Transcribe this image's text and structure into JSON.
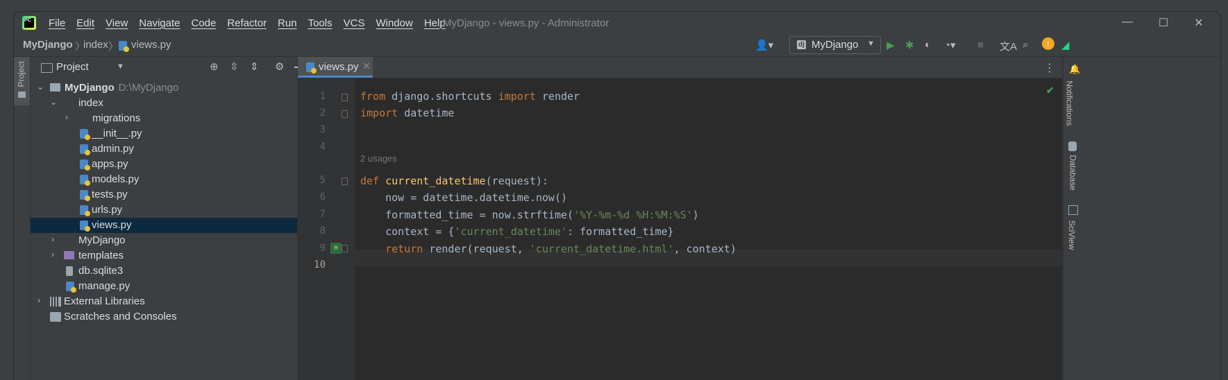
{
  "app": {
    "window_title": "MyDjango - views.py - Administrator",
    "logo_text": "PC",
    "menu": [
      "File",
      "Edit",
      "View",
      "Navigate",
      "Code",
      "Refactor",
      "Run",
      "Tools",
      "VCS",
      "Window",
      "Help"
    ],
    "window_controls": {
      "minimize": "—",
      "maximize": "☐",
      "close": "✕"
    }
  },
  "navbar": {
    "breadcrumbs": [
      "MyDjango",
      "index",
      "views.py"
    ],
    "run_config": "MyDjango",
    "run_config_icon": "dj"
  },
  "left_stripe": {
    "project_tab": "Project"
  },
  "project_panel": {
    "title": "Project",
    "tree": [
      {
        "label": "MyDjango",
        "path": "D:\\MyDjango",
        "indent": 0,
        "expanded": true,
        "icon": "folder"
      },
      {
        "label": "index",
        "indent": 1,
        "expanded": true,
        "icon": "module-folder"
      },
      {
        "label": "migrations",
        "indent": 2,
        "expanded": false,
        "icon": "module-folder"
      },
      {
        "label": "__init__.py",
        "indent": 3,
        "icon": "python-file"
      },
      {
        "label": "admin.py",
        "indent": 3,
        "icon": "python-file"
      },
      {
        "label": "apps.py",
        "indent": 3,
        "icon": "python-file"
      },
      {
        "label": "models.py",
        "indent": 3,
        "icon": "python-file"
      },
      {
        "label": "tests.py",
        "indent": 3,
        "icon": "python-file"
      },
      {
        "label": "urls.py",
        "indent": 3,
        "icon": "python-file"
      },
      {
        "label": "views.py",
        "indent": 3,
        "icon": "python-file",
        "selected": true
      },
      {
        "label": "MyDjango",
        "indent": 1,
        "expanded": false,
        "icon": "module-folder"
      },
      {
        "label": "templates",
        "indent": 1,
        "expanded": false,
        "icon": "templates-folder"
      },
      {
        "label": "db.sqlite3",
        "indent": 2,
        "icon": "database-file"
      },
      {
        "label": "manage.py",
        "indent": 2,
        "icon": "python-file"
      },
      {
        "label": "External Libraries",
        "indent": 0,
        "expanded": false,
        "icon": "library"
      },
      {
        "label": "Scratches and Consoles",
        "indent": 1,
        "icon": "scratch"
      }
    ]
  },
  "editor": {
    "tab": "views.py",
    "usages_hint": "2 usages",
    "line_numbers": [
      "1",
      "2",
      "3",
      "4",
      "5",
      "6",
      "7",
      "8",
      "9",
      "10"
    ],
    "current_line": "10"
  },
  "right_stripe": {
    "tabs": [
      "Notifications",
      "Database",
      "SciView"
    ]
  },
  "colors": {
    "keyword": "#cc7832",
    "function": "#ffc66d",
    "string": "#6a8759",
    "text": "#a9b7c6",
    "selection": "#0d293e"
  }
}
